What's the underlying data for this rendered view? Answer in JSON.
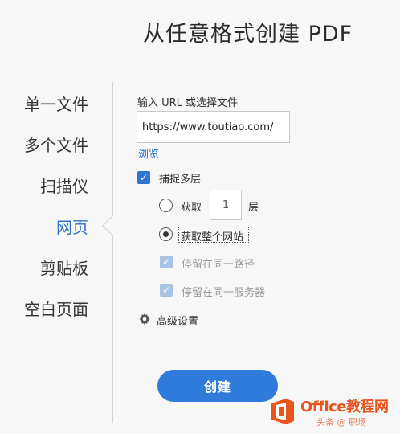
{
  "page": {
    "title": "从任意格式创建 PDF"
  },
  "sidebar": {
    "items": [
      {
        "label": "单一文件",
        "active": false
      },
      {
        "label": "多个文件",
        "active": false
      },
      {
        "label": "扫描仪",
        "active": false
      },
      {
        "label": "网页",
        "active": true
      },
      {
        "label": "剪贴板",
        "active": false
      },
      {
        "label": "空白页面",
        "active": false
      }
    ]
  },
  "form": {
    "url_label": "输入 URL 或选择文件",
    "url_value": "https://www.toutiao.com/",
    "browse_label": "浏览",
    "capture_multilevel": {
      "label": "捕捉多层",
      "checked": true
    },
    "get_levels": {
      "label": "获取",
      "value": "1",
      "suffix": "层",
      "selected": false
    },
    "get_whole_site": {
      "label": "获取整个网站",
      "selected": true
    },
    "stay_same_path": {
      "label": "停留在同一路径",
      "checked": true,
      "disabled": true
    },
    "stay_same_server": {
      "label": "停留在同一服务器",
      "checked": true,
      "disabled": true
    },
    "advanced_settings_label": "高级设置",
    "create_button_label": "创建"
  },
  "watermark": {
    "title": "Office教程网",
    "subtitle": "头条 @ 职场"
  },
  "colors": {
    "accent": "#2d70c7",
    "button": "#2f7bdc",
    "checkbox": "#2f76d2",
    "watermark": "#e8541c"
  }
}
